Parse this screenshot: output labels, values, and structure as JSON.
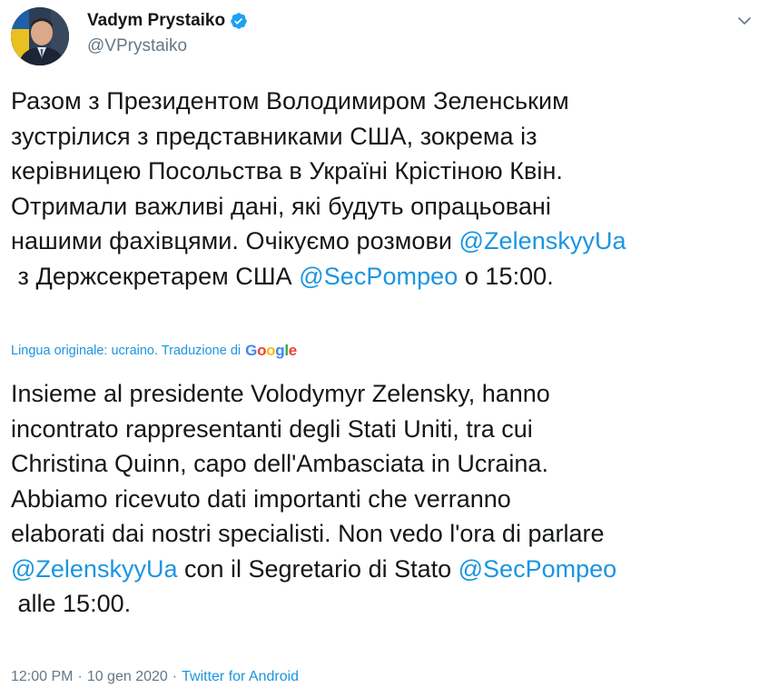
{
  "author": {
    "display_name": "Vadym Prystaiko",
    "handle": "@VPrystaiko",
    "verified": true
  },
  "original": {
    "lines": [
      "Разом з Президентом Володимиром Зеленським",
      "зустрілися з представниками США, зокрема із",
      "керівницею Посольства в Україні Крістіною Квін.",
      "Отримали важливі дані, які будуть опрацьовані",
      "нашими фахівцями. Очікуємо розмови "
    ],
    "mention1": "@ZelenskyyUa",
    "line6_pre": " з Держсекретарем США ",
    "mention2": "@SecPompeo",
    "line6_post": " о 15:00."
  },
  "translation_info": {
    "label": "Lingua originale: ucraino. Traduzione di",
    "provider_letters": [
      "G",
      "o",
      "o",
      "g",
      "l",
      "e"
    ],
    "provider_colors": [
      "#4285f4",
      "#ea4335",
      "#fbbc05",
      "#4285f4",
      "#34a853",
      "#ea4335"
    ]
  },
  "translation": {
    "lines": [
      "Insieme al presidente Volodymyr Zelensky, hanno",
      "incontrato rappresentanti degli Stati Uniti, tra cui",
      "Christina Quinn, capo dell'Ambasciata in Ucraina.",
      "Abbiamo ricevuto dati importanti che verranno",
      "elaborati dai nostri specialisti. Non vedo l'ora di parlare"
    ],
    "mention1": "@ZelenskyyUa",
    "mid": " con il Segretario di Stato ",
    "mention2": "@SecPompeo",
    "last": " alle 15:00."
  },
  "meta": {
    "time": "12:00 PM",
    "separator1": "·",
    "date": "10 gen 2020",
    "separator2": "·",
    "source": "Twitter for Android"
  },
  "colors": {
    "link": "#1b95e0",
    "secondary": "#657786",
    "text": "#14171a",
    "verified": "#1da1f2"
  },
  "icons": {
    "verified": "verified-badge-icon",
    "menu": "chevron-down-icon"
  }
}
